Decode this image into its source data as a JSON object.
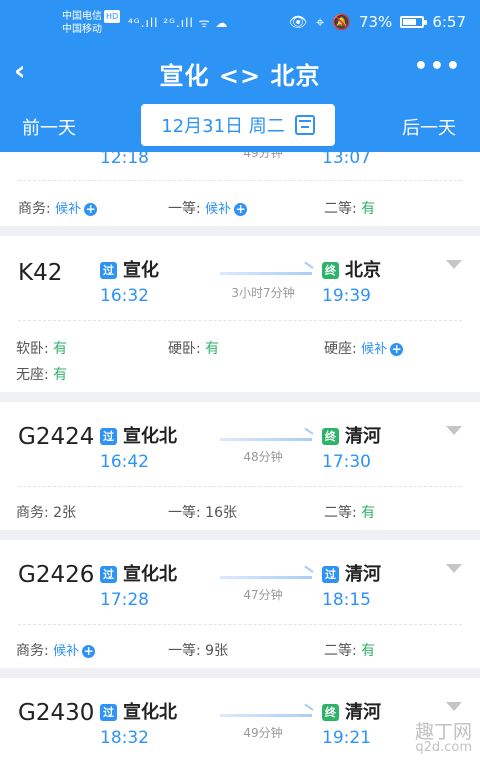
{
  "status": {
    "carrier1": "中国电信",
    "hd": "HD",
    "carrier2": "中国移动",
    "signals": "⁴ᴳ.ıll ²ᴳ.ıll ᯤ ☁",
    "battery_pct_text": "73%",
    "battery_level": 0.73,
    "time": "6:57"
  },
  "header": {
    "back_icon": "‹",
    "title": "宣化 <> 北京",
    "more_icon": "•••"
  },
  "datebar": {
    "prev": "前一天",
    "date": "12月31日 周二",
    "next": "后一天"
  },
  "trains": [
    {
      "number": "",
      "dep_time": "12:18",
      "duration": "49分钟",
      "arr_time": "13:07",
      "seats": [
        {
          "label": "商务: ",
          "value": "候补",
          "type": "wait"
        },
        {
          "label": "一等: ",
          "value": "候补",
          "type": "wait"
        },
        {
          "label": "二等: ",
          "value": "有",
          "type": "ok"
        }
      ]
    },
    {
      "number": "K42",
      "dep_badge": "过",
      "dep_station": "宣化",
      "dep_time": "16:32",
      "duration": "3小时7分钟",
      "arr_badge": "终",
      "arr_station": "北京",
      "arr_time": "19:39",
      "seats": [
        {
          "label": "软卧: ",
          "value": "有",
          "type": "ok"
        },
        {
          "label": "硬卧: ",
          "value": "有",
          "type": "ok"
        },
        {
          "label": "硬座: ",
          "value": "候补",
          "type": "wait"
        },
        {
          "label": "无座: ",
          "value": "有",
          "type": "ok"
        }
      ]
    },
    {
      "number": "G2424",
      "dep_badge": "过",
      "dep_station": "宣化北",
      "dep_time": "16:42",
      "duration": "48分钟",
      "arr_badge": "终",
      "arr_station": "清河",
      "arr_time": "17:30",
      "seats": [
        {
          "label": "商务: ",
          "value": "2张",
          "type": "val"
        },
        {
          "label": "一等: ",
          "value": "16张",
          "type": "val"
        },
        {
          "label": "二等: ",
          "value": "有",
          "type": "ok"
        }
      ]
    },
    {
      "number": "G2426",
      "dep_badge": "过",
      "dep_station": "宣化北",
      "dep_time": "17:28",
      "duration": "47分钟",
      "arr_badge": "过",
      "arr_station": "清河",
      "arr_time": "18:15",
      "seats": [
        {
          "label": "商务: ",
          "value": "候补",
          "type": "wait"
        },
        {
          "label": "一等: ",
          "value": "9张",
          "type": "val"
        },
        {
          "label": "二等: ",
          "value": "有",
          "type": "ok"
        }
      ]
    },
    {
      "number": "G2430",
      "dep_badge": "过",
      "dep_station": "宣化北",
      "dep_time": "18:32",
      "duration": "49分钟",
      "arr_badge": "终",
      "arr_station": "清河",
      "arr_time": "19:21"
    }
  ],
  "watermark": {
    "line1": "趣丁网",
    "line2": "q2d.com"
  },
  "colors": {
    "primary": "#2d93f5",
    "available": "#2fb36a"
  }
}
